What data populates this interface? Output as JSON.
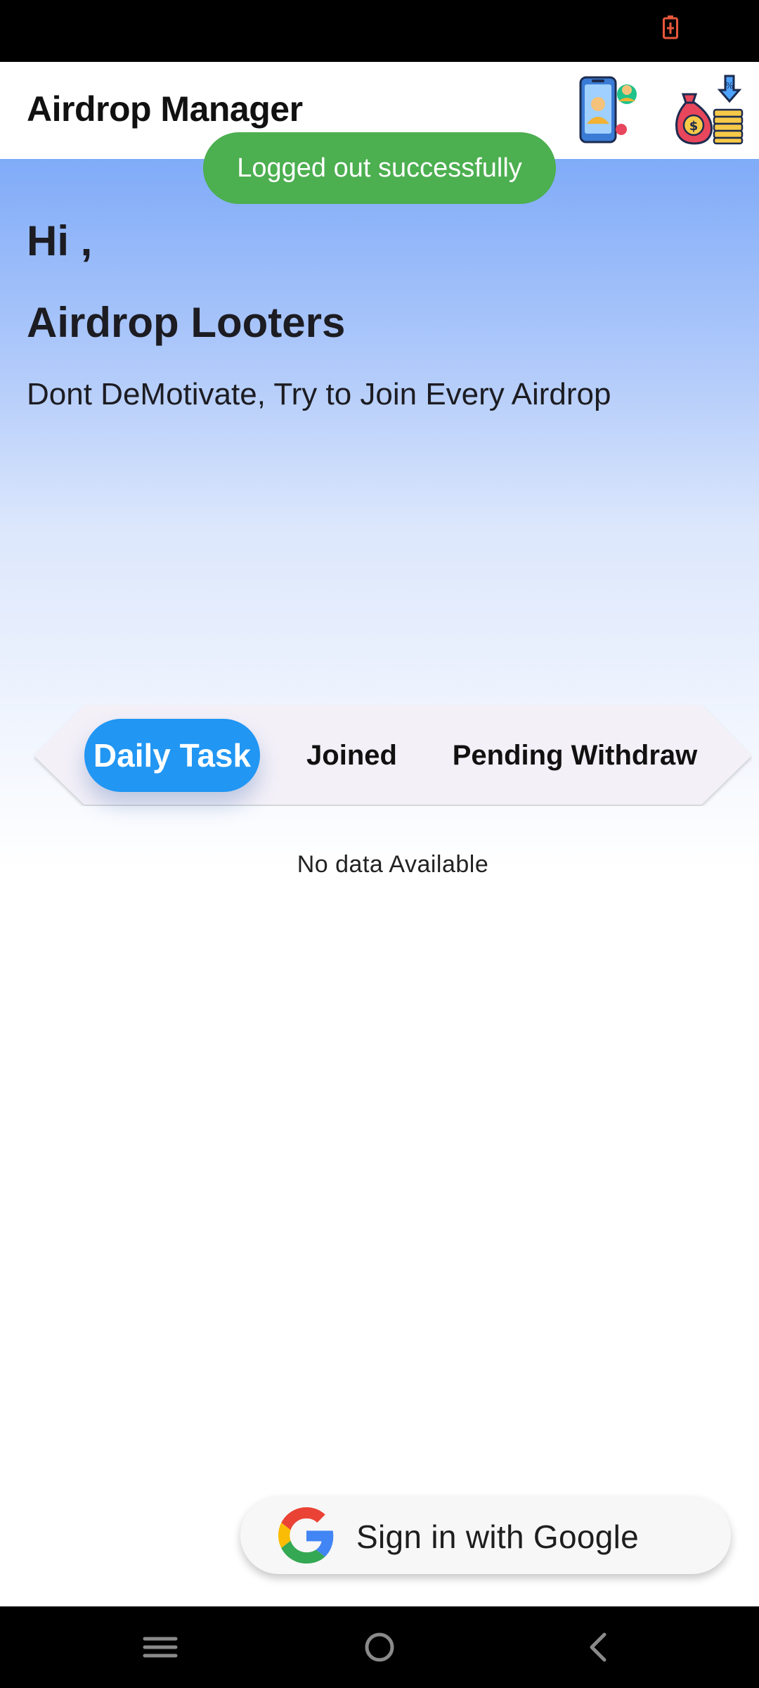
{
  "app_bar": {
    "title": "Airdrop Manager",
    "profile_icon": "phone-user-icon",
    "withdraw_icon": "money-bag-coins-icon"
  },
  "toast": {
    "message": "Logged out successfully",
    "color": "#4caf50"
  },
  "hero": {
    "greeting": "Hi ,",
    "username": "Airdrop Looters",
    "tagline": "Dont DeMotivate, Try to Join Every Airdrop"
  },
  "tabs": [
    {
      "label": "Daily Task",
      "active": true
    },
    {
      "label": "Joined",
      "active": false
    },
    {
      "label": "Pending Withdraw",
      "active": false
    }
  ],
  "empty_state": "No data Available",
  "google_button": {
    "label": "Sign in with Google",
    "icon": "google-icon"
  },
  "nav_bar": {
    "menu_icon": "menu-icon",
    "home_icon": "home-circle-icon",
    "back_icon": "back-chevron-icon"
  },
  "colors": {
    "accent": "#2196f3",
    "hero_top": "#80abf8",
    "tab_bar_bg": "#f3f0f8"
  }
}
